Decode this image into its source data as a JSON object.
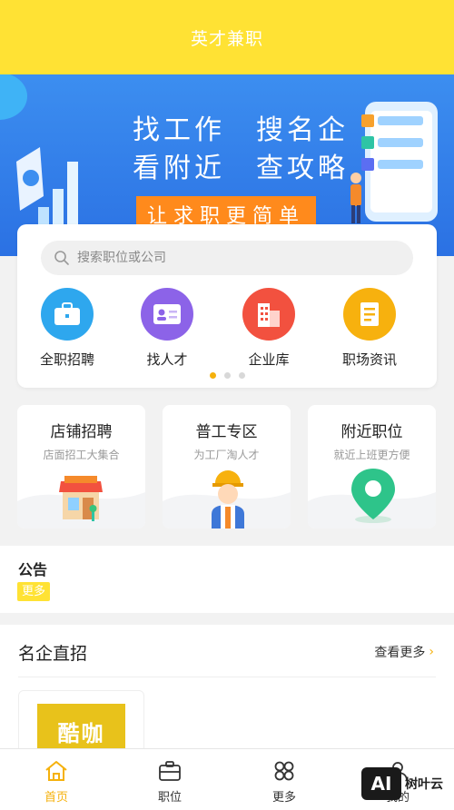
{
  "header": {
    "title": "英才兼职"
  },
  "banner": {
    "line1": "找工作　搜名企",
    "line2": "看附近　查攻略",
    "slogan": "让求职更简单"
  },
  "search": {
    "placeholder": "搜索职位或公司"
  },
  "categories": [
    {
      "label": "全职招聘",
      "icon": "briefcase-icon",
      "color": "#2ea7ee"
    },
    {
      "label": "找人才",
      "icon": "id-card-icon",
      "color": "#8c63e8"
    },
    {
      "label": "企业库",
      "icon": "building-icon",
      "color": "#f2513f"
    },
    {
      "label": "职场资讯",
      "icon": "document-icon",
      "color": "#f7b10e"
    }
  ],
  "features": [
    {
      "title": "店铺招聘",
      "subtitle": "店面招工大集合",
      "icon": "shop-icon"
    },
    {
      "title": "普工专区",
      "subtitle": "为工厂淘人才",
      "icon": "worker-icon"
    },
    {
      "title": "附近职位",
      "subtitle": "就近上班更方便",
      "icon": "location-pin-icon"
    }
  ],
  "notice": {
    "title": "公告",
    "more": "更多"
  },
  "famous": {
    "title": "名企直招",
    "more": "查看更多",
    "company_logo_text": "酷咖"
  },
  "tabbar": [
    {
      "label": "首页",
      "icon": "home-icon",
      "active": true
    },
    {
      "label": "职位",
      "icon": "briefcase-icon",
      "active": false
    },
    {
      "label": "更多",
      "icon": "grid-icon",
      "active": false
    },
    {
      "label": "我的",
      "icon": "user-icon",
      "active": false
    }
  ],
  "watermark": {
    "box": "AI",
    "text": "树叶云"
  },
  "colors": {
    "accent": "#ffe234",
    "active": "#f5b10c",
    "banner": "#2b71e3"
  }
}
